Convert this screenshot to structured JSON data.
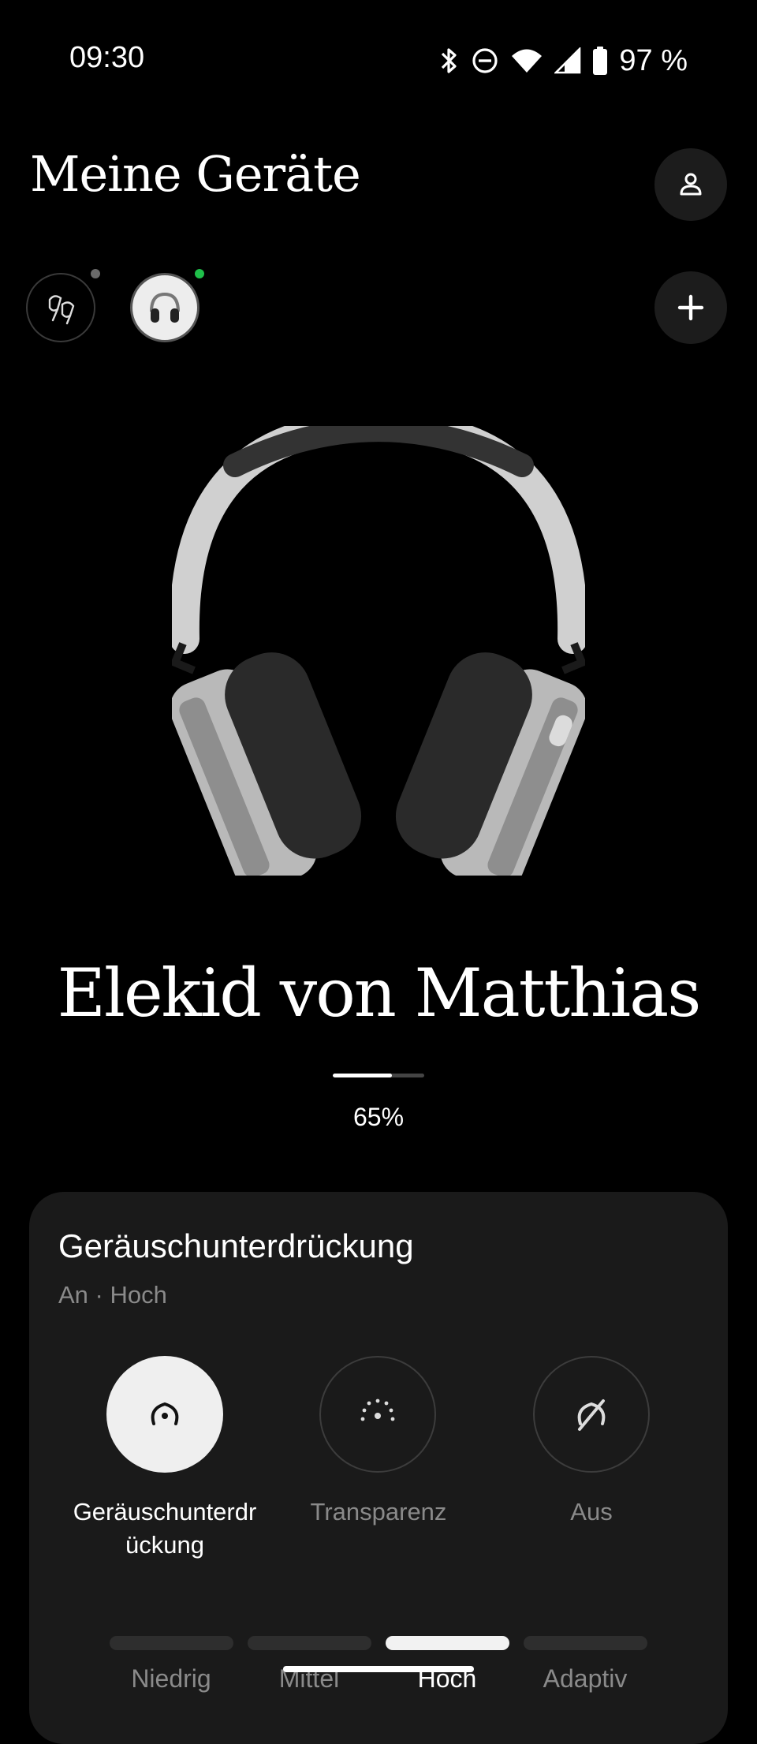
{
  "status_bar": {
    "time": "09:30",
    "battery_text": "97 %",
    "icons": [
      "bluetooth-icon",
      "do-not-disturb-icon",
      "wifi-icon",
      "signal-icon",
      "battery-icon"
    ]
  },
  "header": {
    "title": "Meine Geräte",
    "profile_icon": "person-icon",
    "add_icon": "plus-icon"
  },
  "devices": [
    {
      "icon": "earbuds-icon",
      "status_color": "#6a6a6a",
      "selected": false
    },
    {
      "icon": "headphones-icon",
      "status_color": "#1fbf4a",
      "selected": true
    }
  ],
  "device": {
    "name": "Elekid von Matthias",
    "battery_percent": 65,
    "battery_label": "65%"
  },
  "noise_control": {
    "title": "Geräuschunterdrückung",
    "subtitle": "An · Hoch",
    "modes": [
      {
        "label": "Geräuschunterdr\nückung",
        "icon": "noise-cancelling-icon",
        "active": true
      },
      {
        "label": "Transparenz",
        "icon": "transparency-icon",
        "active": false
      },
      {
        "label": "Aus",
        "icon": "off-icon",
        "active": false
      }
    ],
    "levels": [
      {
        "label": "Niedrig",
        "active": false
      },
      {
        "label": "Mittel",
        "active": false
      },
      {
        "label": "Hoch",
        "active": true
      },
      {
        "label": "Adaptiv",
        "active": false
      }
    ]
  },
  "colors": {
    "background": "#000000",
    "card": "#1a1a1a",
    "status_connected": "#1fbf4a",
    "text_muted": "#8a8a8a"
  }
}
